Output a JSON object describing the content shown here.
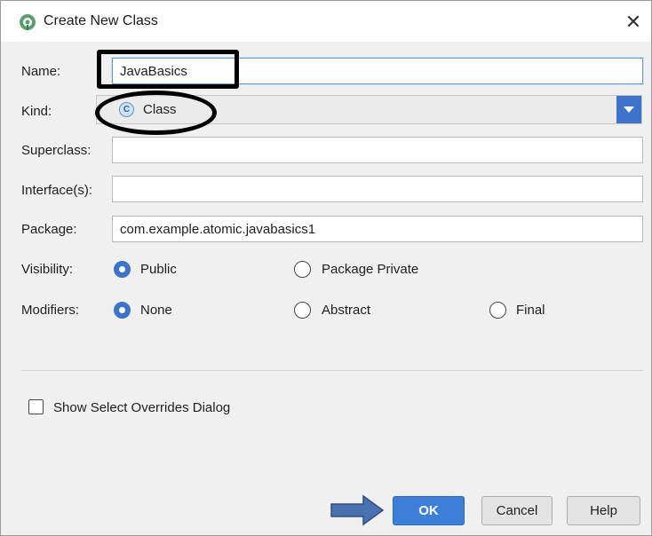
{
  "window": {
    "title": "Create New Class",
    "close_glyph": "✕",
    "app_icon": "android-studio-icon"
  },
  "form": {
    "name": {
      "label": "Name:",
      "value": "JavaBasics"
    },
    "kind": {
      "label": "Kind:",
      "value": "Class",
      "icon": "class-icon",
      "icon_letter": "C"
    },
    "superclass": {
      "label": "Superclass:",
      "value": ""
    },
    "interfaces": {
      "label": "Interface(s):",
      "value": ""
    },
    "package": {
      "label": "Package:",
      "value": "com.example.atomic.javabasics1"
    },
    "visibility": {
      "label": "Visibility:",
      "options": [
        {
          "label": "Public",
          "selected": true
        },
        {
          "label": "Package Private",
          "selected": false
        }
      ]
    },
    "modifiers": {
      "label": "Modifiers:",
      "options": [
        {
          "label": "None",
          "selected": true
        },
        {
          "label": "Abstract",
          "selected": false
        },
        {
          "label": "Final",
          "selected": false
        }
      ]
    },
    "show_overrides": {
      "label": "Show Select Overrides Dialog",
      "checked": false
    }
  },
  "buttons": {
    "ok": "OK",
    "cancel": "Cancel",
    "help": "Help"
  },
  "colors": {
    "accent": "#3d73c9",
    "ok_button": "#3d7ed8",
    "arrow_annotation": "#4a72b0",
    "annotation_outline": "#000000"
  }
}
